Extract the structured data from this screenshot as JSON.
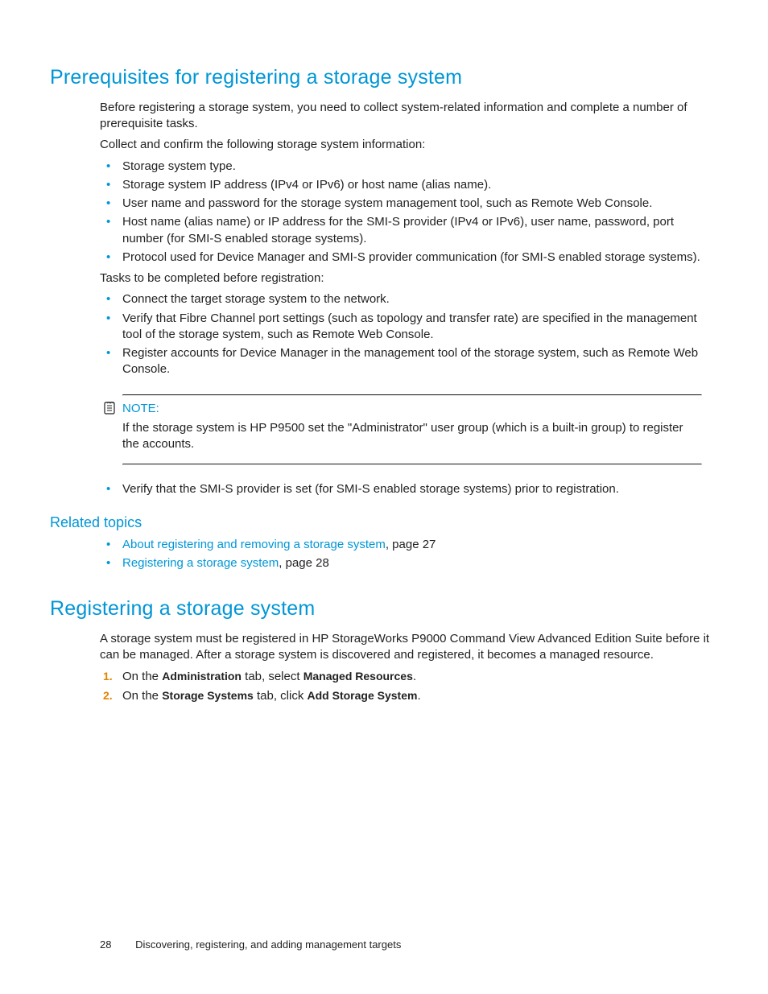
{
  "section1": {
    "heading": "Prerequisites for registering a storage system",
    "intro": "Before registering a storage system, you need to collect system-related information and complete a number of prerequisite tasks.",
    "collect_lead": "Collect and confirm the following storage system information:",
    "collect_items": [
      "Storage system type.",
      "Storage system IP address (IPv4 or IPv6) or host name (alias name).",
      "User name and password for the storage system management tool, such as Remote Web Console.",
      "Host name (alias name) or IP address for the SMI-S provider (IPv4 or IPv6), user name, password, port number (for SMI-S enabled storage systems).",
      "Protocol used for Device Manager and SMI-S provider communication (for SMI-S enabled storage systems)."
    ],
    "tasks_lead": "Tasks to be completed before registration:",
    "tasks_items": [
      "Connect the target storage system to the network.",
      "Verify that Fibre Channel port settings (such as topology and transfer rate) are specified in the management tool of the storage system, such as Remote Web Console.",
      "Register accounts for Device Manager in the management tool of the storage system, such as Remote Web Console."
    ],
    "note_label": "NOTE:",
    "note_body": "If the storage system is HP P9500 set the \"Administrator\" user group (which is a built-in group) to register the accounts.",
    "post_note_item": "Verify that the SMI-S provider is set (for SMI-S enabled storage systems) prior to registration."
  },
  "related": {
    "heading": "Related topics",
    "items": [
      {
        "link": "About registering and removing a storage system",
        "suffix": ", page 27"
      },
      {
        "link": "Registering a storage system",
        "suffix": ", page 28"
      }
    ]
  },
  "section2": {
    "heading": "Registering a storage system",
    "intro": "A storage system must be registered in HP StorageWorks P9000 Command View Advanced Edition Suite before it can be managed. After a storage system is discovered and registered, it becomes a managed resource.",
    "steps": [
      {
        "pre": "On the ",
        "b1": "Administration",
        "mid": " tab, select ",
        "b2": "Managed Resources",
        "post": "."
      },
      {
        "pre": "On the ",
        "b1": "Storage Systems",
        "mid": " tab, click ",
        "b2": "Add Storage System",
        "post": "."
      }
    ]
  },
  "footer": {
    "page_number": "28",
    "chapter": "Discovering, registering, and adding management targets"
  }
}
